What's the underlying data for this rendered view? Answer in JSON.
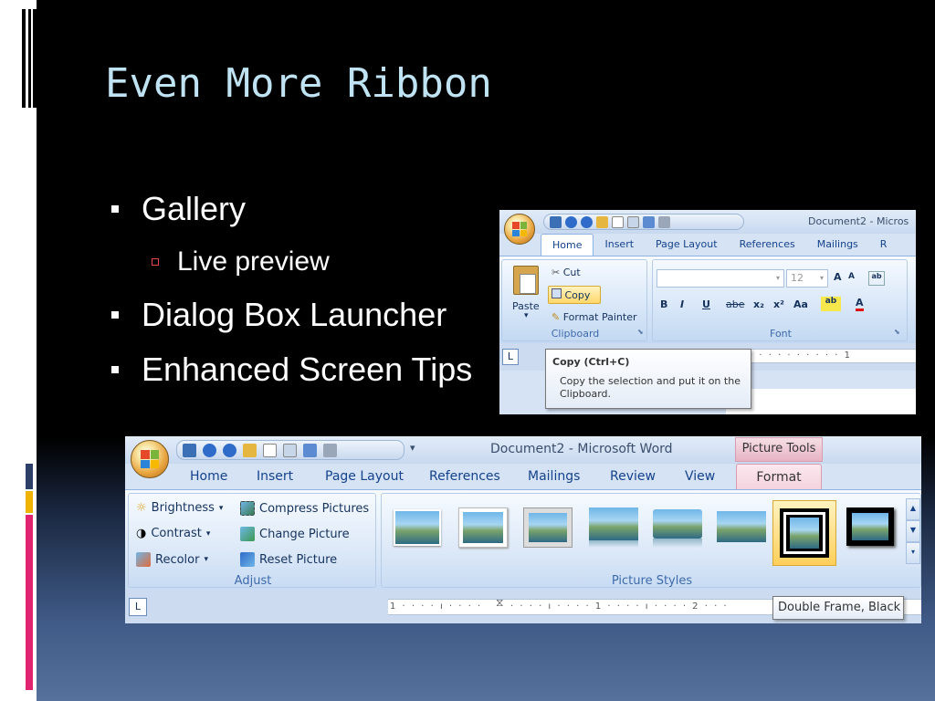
{
  "slide": {
    "title": "Even More Ribbon",
    "bullets": [
      {
        "text": "Gallery",
        "level": 1
      },
      {
        "text": "Live preview",
        "level": 2
      },
      {
        "text": "Dialog Box Launcher",
        "level": 1
      },
      {
        "text": "Enhanced Screen Tips",
        "level": 1
      }
    ]
  },
  "colors": {
    "title": "#bfe3f2",
    "accent_bars": [
      "#2e3f67",
      "#f0b400",
      "#e0246f"
    ],
    "sub_bullet": "#e04848"
  },
  "screenshot1": {
    "window_title": "Document2 - Micros",
    "tabs": [
      "Home",
      "Insert",
      "Page Layout",
      "References",
      "Mailings",
      "R"
    ],
    "active_tab": "Home",
    "clipboard": {
      "paste": "Paste",
      "cut": "Cut",
      "copy": "Copy",
      "format_painter": "Format Painter",
      "group_label": "Clipboard"
    },
    "font": {
      "size": "12",
      "grow": "A",
      "shrink": "A",
      "bold": "B",
      "italic": "I",
      "underline": "U",
      "strike": "abe",
      "subscript": "x₂",
      "superscript": "x²",
      "change_case": "Aa",
      "font_color": "A",
      "group_label": "Font"
    },
    "ruler_tab": "L",
    "ruler_marks": "· · · · · · · · · · 1",
    "tooltip": {
      "title": "Copy (Ctrl+C)",
      "description": "Copy the selection and put it on the Clipboard."
    }
  },
  "screenshot2": {
    "window_title": "Document2 - Microsoft Word",
    "contextual_tab_group": "Picture Tools",
    "tabs": [
      "Home",
      "Insert",
      "Page Layout",
      "References",
      "Mailings",
      "Review",
      "View",
      "Format"
    ],
    "active_tab": "Format",
    "adjust": {
      "brightness": "Brightness",
      "contrast": "Contrast",
      "recolor": "Recolor",
      "compress": "Compress Pictures",
      "change": "Change Picture",
      "reset": "Reset Picture",
      "group_label": "Adjust"
    },
    "styles_group_label": "Picture Styles",
    "ruler_tab": "L",
    "ruler_marks_left": "1 · · · · ı · · · ·",
    "ruler_marks_right": "· · · · ı · · · · 1 · · · · ı · · · · 2 · · ·",
    "tooltip": "Double Frame, Black",
    "gallery_count": 8,
    "selected_style_index": 6
  }
}
